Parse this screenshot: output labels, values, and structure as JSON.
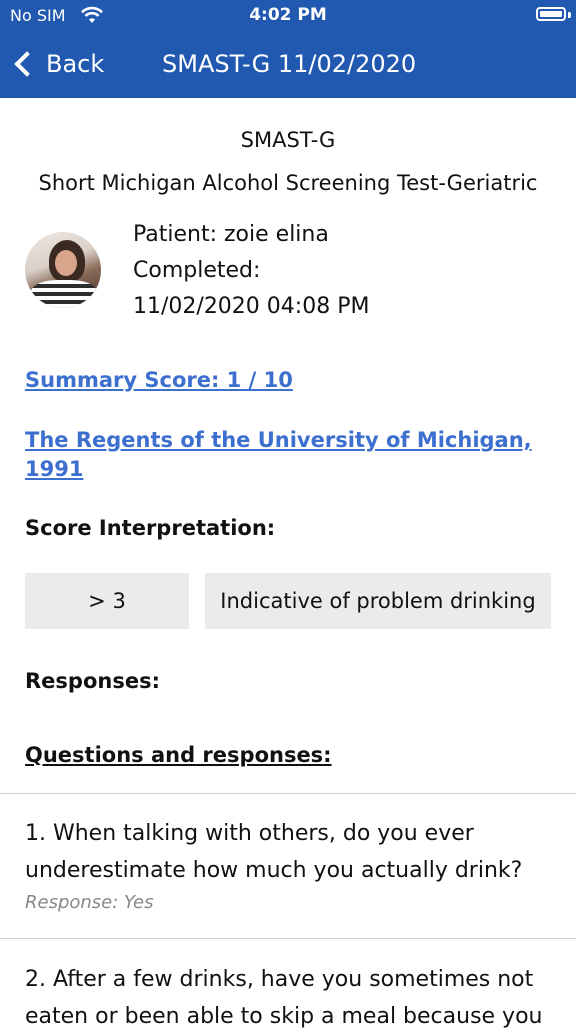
{
  "status_bar": {
    "carrier": "No SIM",
    "time": "4:02 PM",
    "wifi_icon": "wifi-icon",
    "battery_icon": "battery-icon"
  },
  "nav": {
    "back_label": "Back",
    "title": "SMAST-G 11/02/2020",
    "back_icon": "chevron-left-icon"
  },
  "header": {
    "short_name": "SMAST-G",
    "full_name": "Short Michigan Alcohol Screening Test-Geriatric"
  },
  "patient": {
    "name_line": "Patient: zoie elina",
    "completed_label": "Completed:",
    "completed_value": "11/02/2020 04:08 PM"
  },
  "links": {
    "summary_score": "Summary Score: 1 / 10",
    "copyright_line1": "The Regents of the University of Michigan,",
    "copyright_line2": "1991"
  },
  "interpretation": {
    "heading": "Score Interpretation:",
    "rows": [
      {
        "range": "> 3",
        "meaning": "Indicative of problem drinking"
      }
    ]
  },
  "responses": {
    "heading": "Responses:",
    "qa_heading": "Questions and responses:"
  },
  "questions": [
    {
      "line1": "1. When talking with others, do you ever",
      "line2": "underestimate how much you actually drink?",
      "response": "Response: Yes"
    },
    {
      "line1": "2. After a few drinks, have you sometimes not",
      "line2": "eaten or been able to skip a meal because you"
    }
  ],
  "colors": {
    "nav_bar": "#2158b0",
    "link": "#3d6fcf",
    "cell_bg": "#ebebeb"
  }
}
